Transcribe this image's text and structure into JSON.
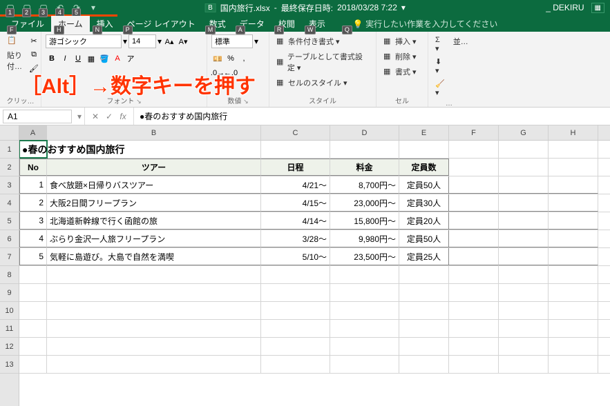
{
  "title": {
    "badge": "B",
    "filename": "国内旅行.xlsx",
    "saved_prefix": "最終保存日時:",
    "saved_time": "2018/03/28 7:22",
    "username": "_ DEKIRU"
  },
  "qat": [
    {
      "icon": "▢",
      "key": "1"
    },
    {
      "icon": "▢",
      "key": "2"
    },
    {
      "icon": "▢",
      "key": "3"
    },
    {
      "icon": "↶",
      "key": "4"
    },
    {
      "icon": "↷",
      "key": "5"
    }
  ],
  "tabs": [
    {
      "label": "ファイル",
      "key": "F"
    },
    {
      "label": "ホーム",
      "key": "H",
      "active": true
    },
    {
      "label": "挿入",
      "key": "N"
    },
    {
      "label": "ページ レイアウト",
      "key": "P"
    },
    {
      "label": "数式",
      "key": "M"
    },
    {
      "label": "データ",
      "key": "A"
    },
    {
      "label": "校閲",
      "key": "R"
    },
    {
      "label": "表示",
      "key": "W"
    }
  ],
  "tellme": {
    "icon": "💡",
    "text": "実行したい作業を入力してください",
    "key": "Q"
  },
  "ribbon": {
    "clipboard": {
      "label": "クリッ…",
      "paste": "貼り付…"
    },
    "font": {
      "label": "フォント",
      "name": "游ゴシック",
      "size": "14"
    },
    "number": {
      "label": "数値",
      "style": "標準"
    },
    "styles": {
      "label": "スタイル",
      "items": [
        "条件付き書式 ▾",
        "テーブルとして書式設定 ▾",
        "セルのスタイル ▾"
      ]
    },
    "cells": {
      "label": "セル",
      "items": [
        "挿入 ▾",
        "削除 ▾",
        "書式 ▾"
      ]
    },
    "editing": {
      "label": "…",
      "items": [
        "Σ ▾",
        "⬇ ▾",
        "🧹 ▾"
      ],
      "side": "並…"
    }
  },
  "overlay": "［Alt］→数字キーを押す",
  "namebox": "A1",
  "formula": "●春のおすすめ国内旅行",
  "cols": [
    "A",
    "B",
    "C",
    "D",
    "E",
    "F",
    "G",
    "H"
  ],
  "rows": [
    "1",
    "2",
    "3",
    "4",
    "5",
    "6",
    "7",
    "8",
    "9",
    "10",
    "11",
    "12",
    "13"
  ],
  "sheet": {
    "title": "●春のおすすめ国内旅行",
    "headers": {
      "no": "No",
      "tour": "ツアー",
      "date": "日程",
      "price": "料金",
      "cap": "定員数"
    },
    "data": [
      {
        "no": "1",
        "tour": "食べ放題×日帰りバスツアー",
        "date": "4/21～",
        "price": "8,700円～",
        "cap": "定員50人"
      },
      {
        "no": "2",
        "tour": "大阪2日間フリープラン",
        "date": "4/15～",
        "price": "23,000円～",
        "cap": "定員30人"
      },
      {
        "no": "3",
        "tour": "北海道新幹線で行く函館の旅",
        "date": "4/14～",
        "price": "15,800円～",
        "cap": "定員20人"
      },
      {
        "no": "4",
        "tour": "ぶらり金沢一人旅フリープラン",
        "date": "3/28～",
        "price": "9,980円～",
        "cap": "定員50人"
      },
      {
        "no": "5",
        "tour": "気軽に島遊び。大島で自然を満喫",
        "date": "5/10～",
        "price": "23,500円～",
        "cap": "定員25人"
      }
    ]
  }
}
